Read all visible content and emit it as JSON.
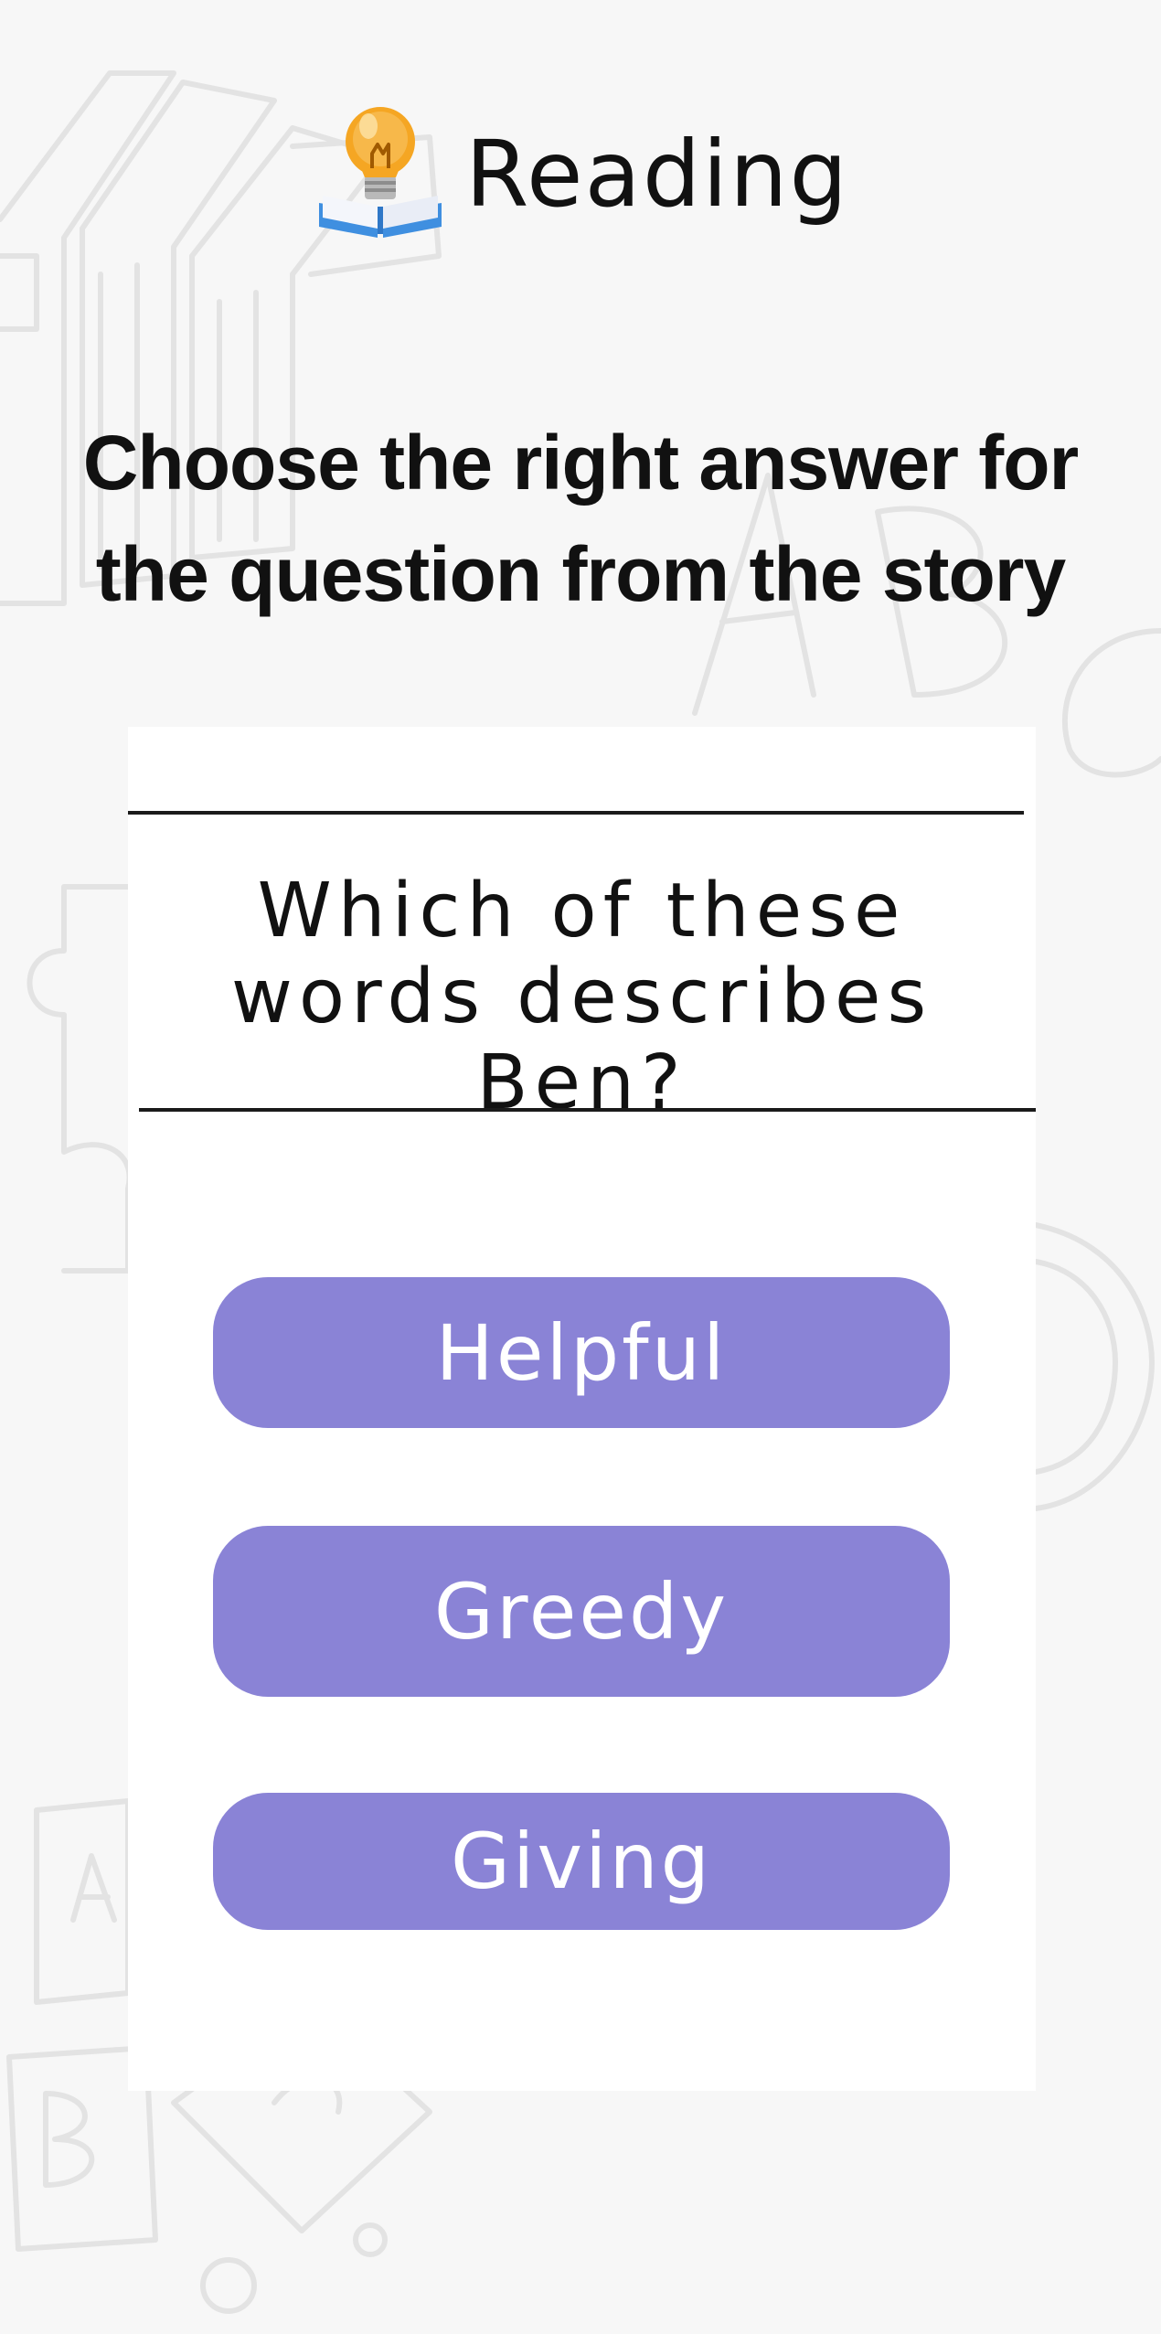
{
  "header": {
    "title": "Reading",
    "icon": "lightbulb-book-icon"
  },
  "instruction": "Choose the right answer for the question from the story",
  "question": {
    "text": "Which of these words describes Ben?"
  },
  "answers": [
    {
      "label": "Helpful"
    },
    {
      "label": "Greedy"
    },
    {
      "label": "Giving"
    }
  ],
  "colors": {
    "background": "#f7f7f7",
    "card": "#ffffff",
    "answer_button": "#8a83d6",
    "answer_text": "#ffffff",
    "text": "#111111",
    "doodle": "#e2e2e2"
  }
}
